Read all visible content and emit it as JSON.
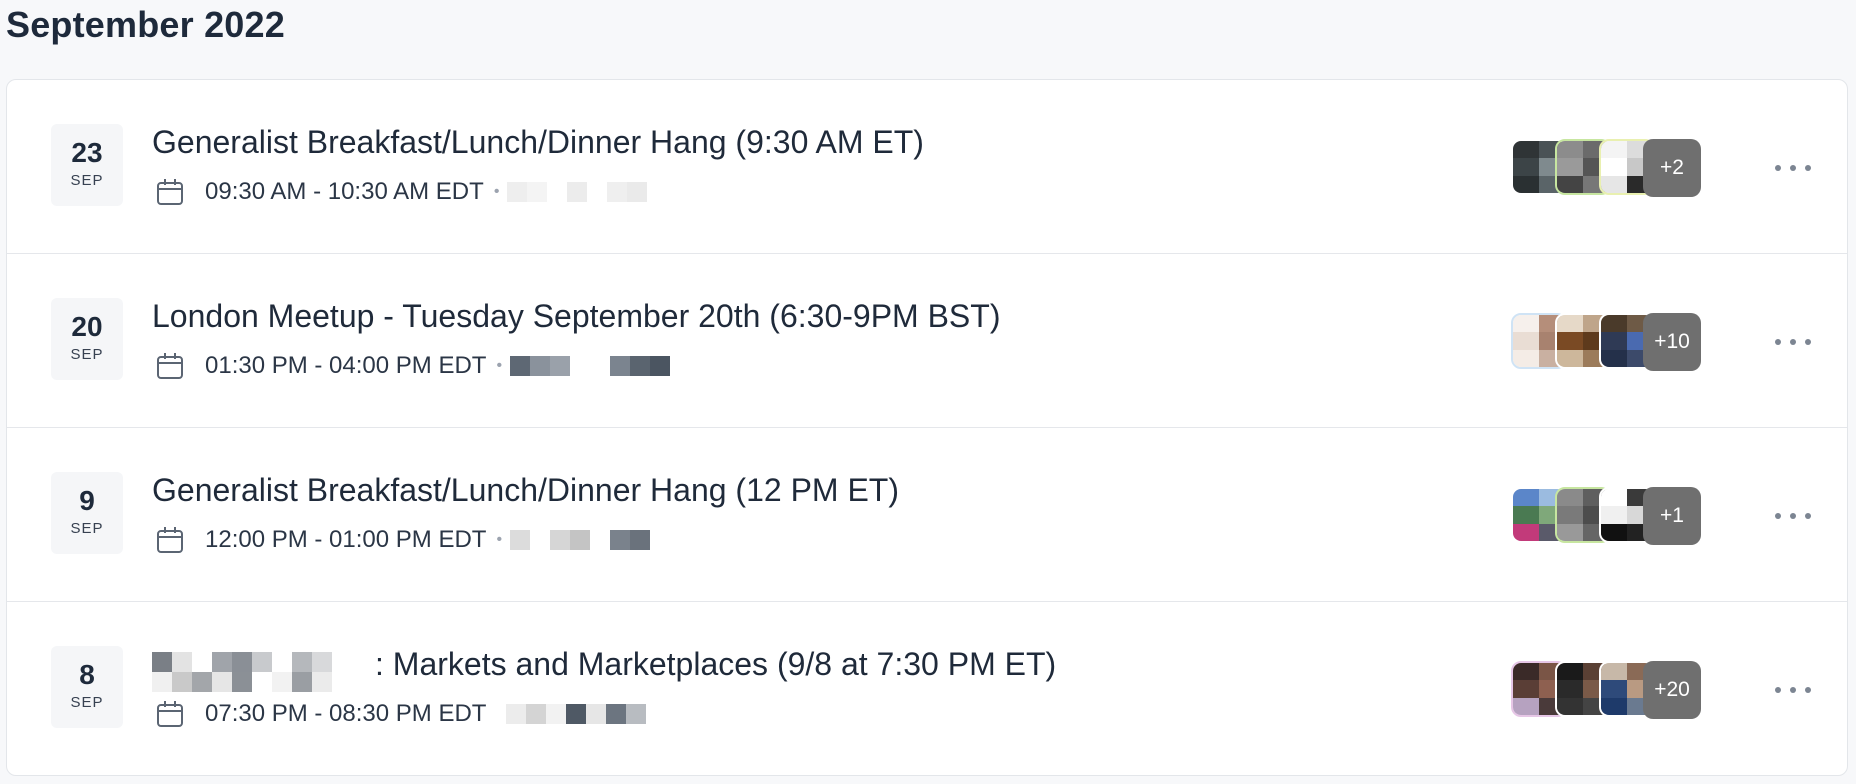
{
  "month_title": "September 2022",
  "events": [
    {
      "day": "23",
      "month": "SEP",
      "title": "Generalist Breakfast/Lunch/Dinner Hang (9:30 AM ET)",
      "time": "09:30 AM - 10:30 AM EDT",
      "extra_attendees": "+2"
    },
    {
      "day": "20",
      "month": "SEP",
      "title": "London Meetup - Tuesday September 20th (6:30-9PM BST)",
      "time": "01:30 PM - 04:00 PM EDT",
      "extra_attendees": "+10"
    },
    {
      "day": "9",
      "month": "SEP",
      "title": "Generalist Breakfast/Lunch/Dinner Hang (12 PM ET)",
      "time": "12:00 PM - 01:00 PM EDT",
      "extra_attendees": "+1"
    },
    {
      "day": "8",
      "month": "SEP",
      "title": ": Markets and Marketplaces (9/8 at 7:30 PM ET)",
      "time": "07:30 PM - 08:30 PM EDT",
      "extra_attendees": "+20"
    }
  ],
  "icons": {
    "calendar": "calendar-icon",
    "more": "more-horizontal-icon"
  },
  "colors": {
    "badge_bg": "#6f6f6f",
    "text_primary": "#1f2a3a",
    "background": "#f7f8fa"
  }
}
